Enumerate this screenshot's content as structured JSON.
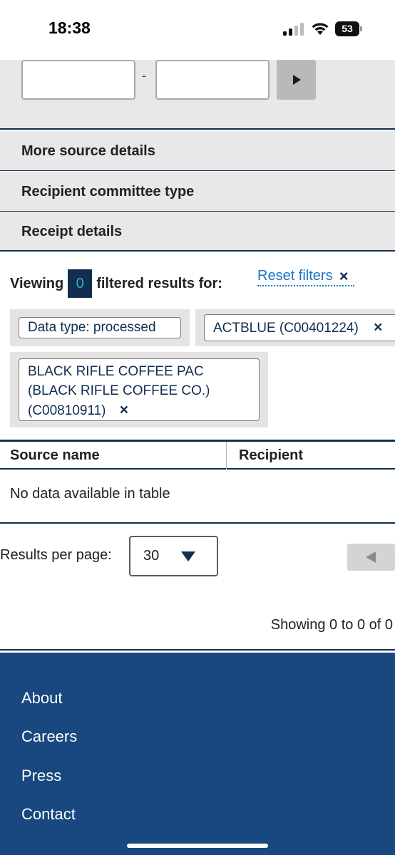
{
  "status_bar": {
    "time": "18:38",
    "battery": "53"
  },
  "date_filter": {
    "separator": "-",
    "from_value": "",
    "to_value": "",
    "go_icon": "play-right-icon"
  },
  "accordions": [
    {
      "label": "More source details"
    },
    {
      "label": "Recipient committee type"
    },
    {
      "label": "Receipt details"
    }
  ],
  "results": {
    "viewing_label": "Viewing",
    "count": "0",
    "filtered_label": "filtered results for:",
    "reset_label": "Reset filters",
    "reset_icon": "×"
  },
  "filter_tags": [
    {
      "text": "Data type: processed"
    },
    {
      "text": "ACTBLUE (C00401224)",
      "remove": "×"
    },
    {
      "line1": "BLACK RIFLE COFFEE PAC",
      "line2": "(BLACK RIFLE COFFEE CO.)",
      "line3": "(C00810911)",
      "remove": "×"
    }
  ],
  "table": {
    "columns": [
      "Source name",
      "Recipient"
    ],
    "empty_message": "No data available in table"
  },
  "pagination": {
    "per_page_label": "Results per page:",
    "per_page_value": "30",
    "showing": "Showing 0 to 0 of 0"
  },
  "footer": {
    "links": [
      "About",
      "Careers",
      "Press",
      "Contact"
    ]
  },
  "colors": {
    "navy": "#112e51",
    "footer_blue": "#18487f",
    "link_blue": "#1a73c6",
    "panel_gray": "#e8e8e8"
  }
}
